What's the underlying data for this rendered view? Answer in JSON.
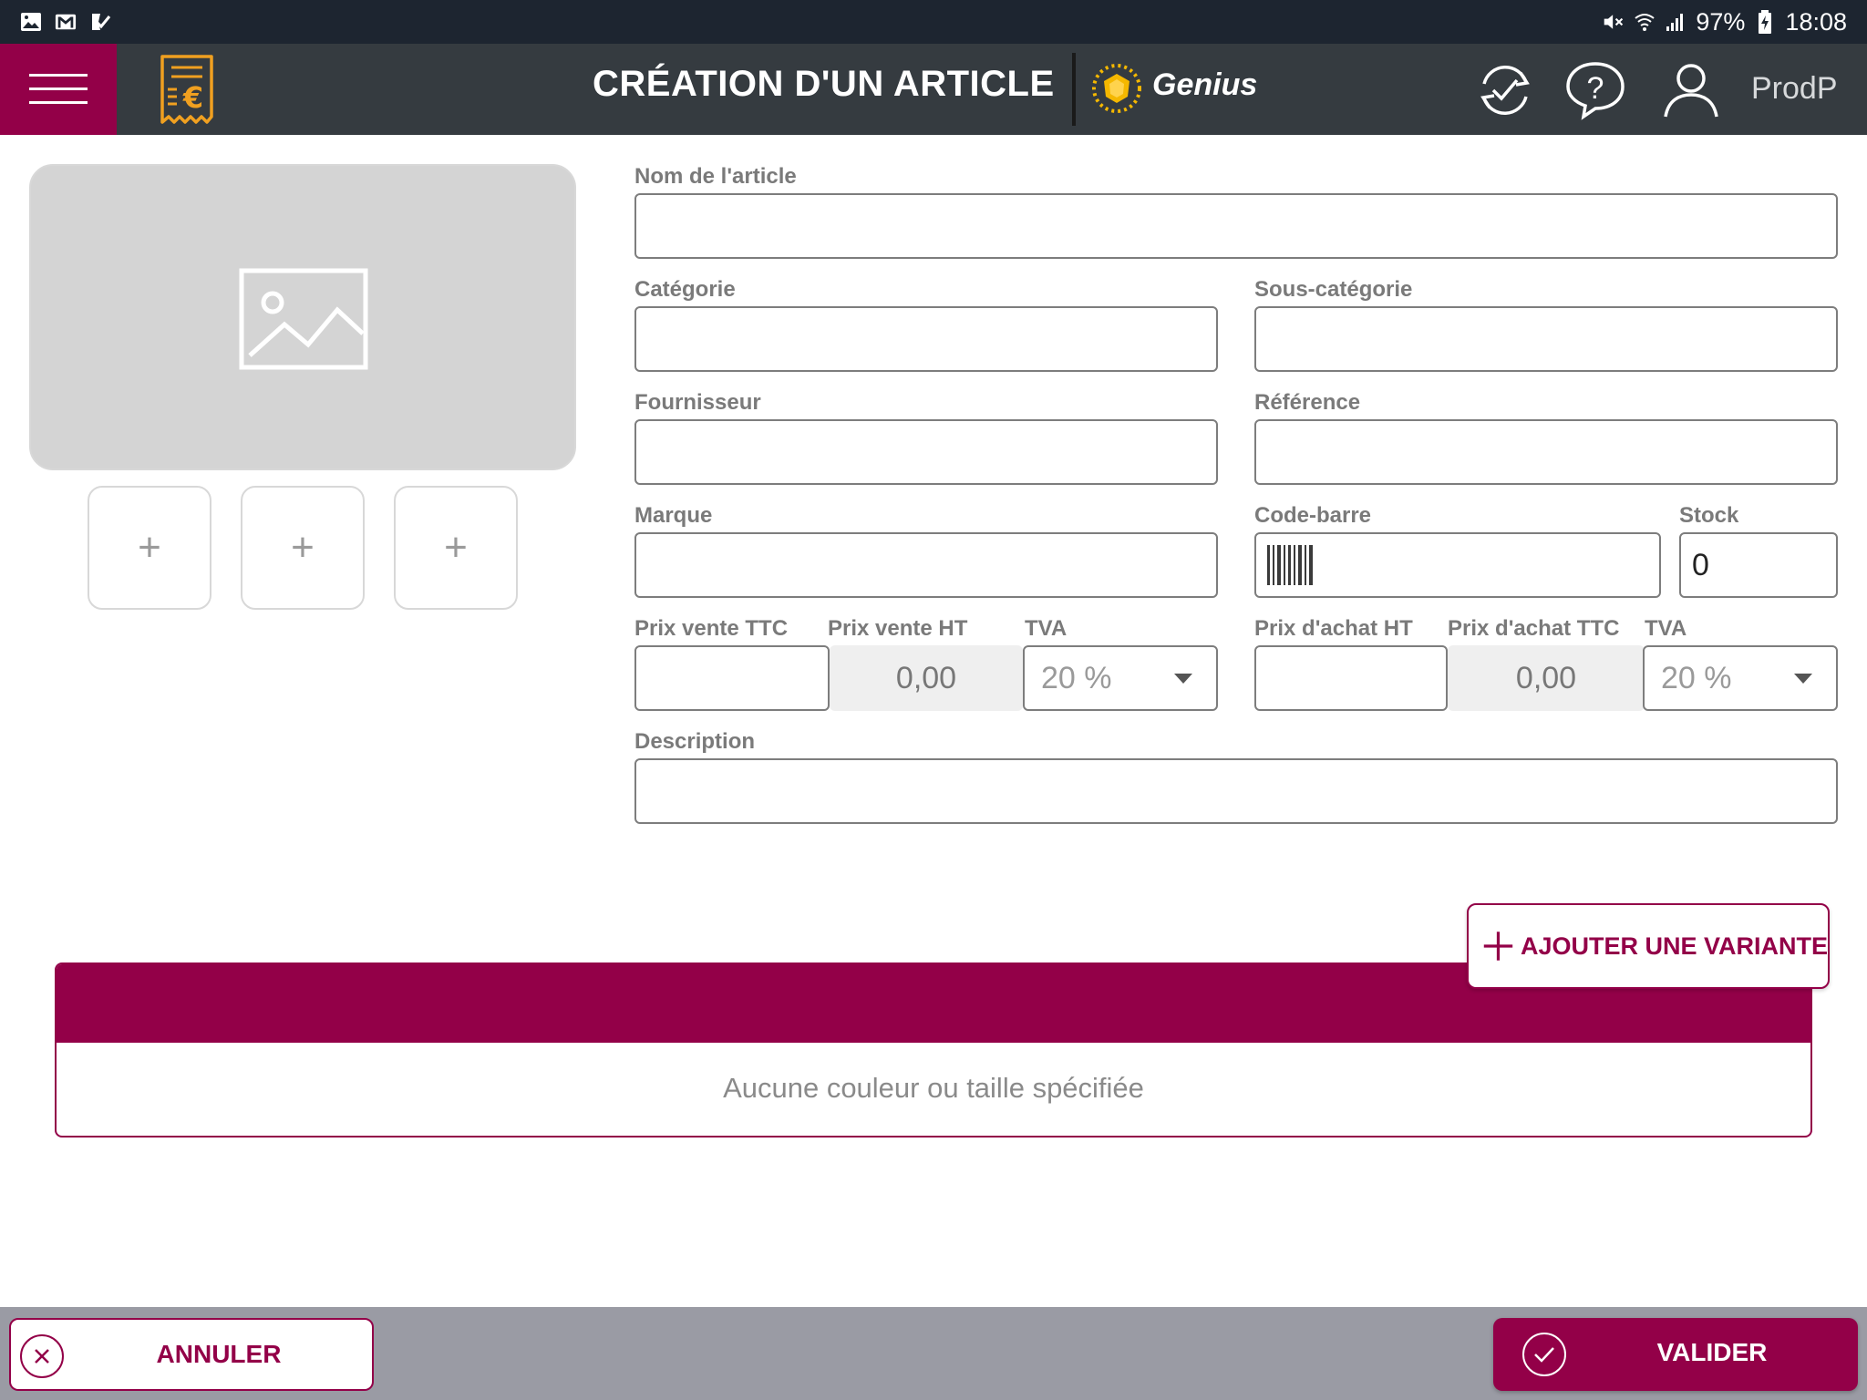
{
  "status_bar": {
    "battery": "97%",
    "time": "18:08",
    "left_icons": [
      "gallery-icon",
      "gmail-icon",
      "clipboard-check-icon"
    ],
    "right_icons": [
      "mute-icon",
      "wifi-icon",
      "signal-icon",
      "battery-charging-icon"
    ]
  },
  "header": {
    "title": "CRÉATION D'UN ARTICLE",
    "brand": "Genius",
    "user": "ProdP",
    "icons": [
      "menu-icon",
      "receipt-euro-icon",
      "sync-icon",
      "help-icon",
      "user-icon"
    ]
  },
  "colors": {
    "accent": "#930048",
    "header_bg": "#353b40",
    "status_bg": "#1d2530",
    "footer_bg": "#9a9ba4",
    "icon_orange": "#f0a020"
  },
  "media": {
    "thumbnails": [
      "+",
      "+",
      "+"
    ]
  },
  "form": {
    "name_label": "Nom de l'article",
    "name_value": "",
    "category_label": "Catégorie",
    "category_value": "",
    "subcategory_label": "Sous-catégorie",
    "subcategory_value": "",
    "supplier_label": "Fournisseur",
    "supplier_value": "",
    "reference_label": "Référence",
    "reference_value": "",
    "brand_label": "Marque",
    "brand_value": "",
    "barcode_label": "Code-barre",
    "barcode_value": "",
    "stock_label": "Stock",
    "stock_value": "0",
    "sale_ttc_label": "Prix vente TTC",
    "sale_ttc_value": "",
    "sale_ht_label": "Prix vente HT",
    "sale_ht_value": "0,00",
    "sale_tva_label": "TVA",
    "sale_tva_value": "20 %",
    "purchase_ht_label": "Prix d'achat HT",
    "purchase_ht_value": "",
    "purchase_ttc_label": "Prix d'achat TTC",
    "purchase_ttc_value": "0,00",
    "purchase_tva_label": "TVA",
    "purchase_tva_value": "20 %",
    "description_label": "Description",
    "description_value": ""
  },
  "variants": {
    "add_label": "AJOUTER UNE VARIANTE",
    "empty_text": "Aucune couleur ou taille spécifiée"
  },
  "footer": {
    "cancel_label": "ANNULER",
    "validate_label": "VALIDER"
  }
}
